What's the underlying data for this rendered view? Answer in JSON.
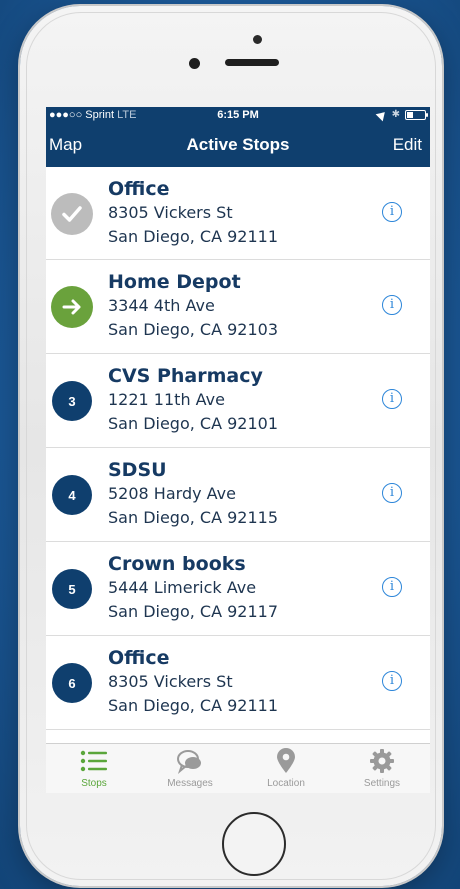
{
  "status_bar": {
    "carrier": "Sprint",
    "network": "LTE",
    "time": "6:15 PM",
    "battery_level": 0.35
  },
  "nav": {
    "left_label": "Map",
    "title": "Active Stops",
    "right_label": "Edit"
  },
  "stops": [
    {
      "marker": "",
      "state": "completed",
      "name": "Office",
      "street": "8305 Vickers St",
      "city": "San Diego, CA 92111"
    },
    {
      "marker": "",
      "state": "current",
      "name": "Home Depot",
      "street": "3344 4th Ave",
      "city": "San Diego, CA 92103"
    },
    {
      "marker": "3",
      "state": "pending",
      "name": "CVS Pharmacy",
      "street": "1221 11th Ave",
      "city": "San Diego, CA 92101"
    },
    {
      "marker": "4",
      "state": "pending",
      "name": "SDSU",
      "street": "5208 Hardy Ave",
      "city": "San Diego, CA 92115"
    },
    {
      "marker": "5",
      "state": "pending",
      "name": "Crown books",
      "street": "5444 Limerick Ave",
      "city": "San Diego, CA 92117"
    },
    {
      "marker": "6",
      "state": "pending",
      "name": "Office",
      "street": "8305 Vickers St",
      "city": "San Diego, CA 92111"
    }
  ],
  "tabs": [
    {
      "label": "Stops",
      "icon": "list-icon",
      "active": true
    },
    {
      "label": "Messages",
      "icon": "chat-bubbles-icon",
      "active": false
    },
    {
      "label": "Location",
      "icon": "map-pin-icon",
      "active": false
    },
    {
      "label": "Settings",
      "icon": "gear-icon",
      "active": false
    }
  ],
  "colors": {
    "nav_bar": "#0f3f6e",
    "completed": "#bcbcbc",
    "current": "#6aa23c",
    "pending": "#0f3f6e",
    "info": "#2d86d9",
    "tab_active": "#5aa63a",
    "tab_inactive": "#9a9a9a"
  }
}
